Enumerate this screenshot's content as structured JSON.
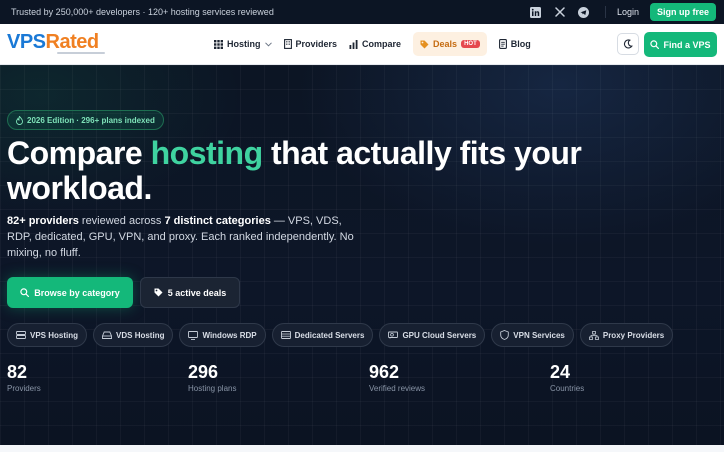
{
  "topbar": {
    "message": "Trusted by 250,000+ developers · 120+ hosting services reviewed",
    "social_icons": [
      "linkedin-icon",
      "x-icon",
      "telegram-icon"
    ],
    "login": "Login",
    "signup": "Sign up free"
  },
  "nav": {
    "logo_vps": "VPS",
    "logo_rated": "Rated",
    "links": {
      "hosting": "Hosting",
      "providers": "Providers",
      "compare": "Compare",
      "deals": "Deals",
      "deals_badge": "HOT",
      "blog": "Blog"
    },
    "find_vps": "Find a VPS"
  },
  "hero": {
    "badge": "2026 Edition · 296+ plans indexed",
    "title_part1": "Compare ",
    "title_highlight": "hosting",
    "title_part2": " that actually fits your workload.",
    "lead_bold1": "82+ providers",
    "lead_text1": " reviewed across ",
    "lead_bold2": "7 distinct categories",
    "lead_text2": " — VPS, VDS, RDP, dedicated, GPU, VPN, and proxy. Each ranked independently. No mixing, no fluff.",
    "browse_button": "Browse by category",
    "deals_button": "5 active deals",
    "categories": [
      "VPS Hosting",
      "VDS Hosting",
      "Windows RDP",
      "Dedicated Servers",
      "GPU Cloud Servers",
      "VPN Services",
      "Proxy Providers"
    ],
    "stats": [
      {
        "value": "82",
        "label": "Providers"
      },
      {
        "value": "296",
        "label": "Hosting plans"
      },
      {
        "value": "962",
        "label": "Verified reviews"
      },
      {
        "value": "24",
        "label": "Countries"
      }
    ]
  },
  "colors": {
    "accent": "#14b87a",
    "highlight": "#3fd3a0",
    "logo_blue": "#1a79d6",
    "logo_orange": "#f08022",
    "hot_badge": "#e5484d",
    "hero_bg": "#0c1524"
  }
}
